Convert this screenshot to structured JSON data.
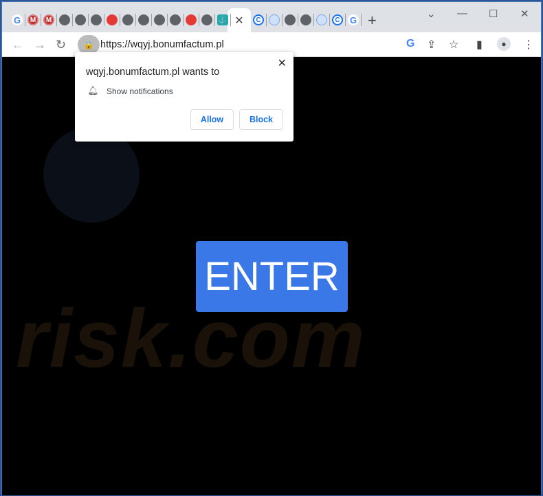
{
  "tabs": {
    "favicons": [
      "google",
      "mega",
      "mega",
      "globe",
      "globe",
      "globe",
      "red-circle",
      "globe",
      "globe",
      "globe",
      "globe",
      "red-circle",
      "globe",
      "shield",
      "ACTIVE",
      "refresh-blue",
      "bell-blue",
      "globe",
      "globe",
      "bell-blue",
      "refresh-blue",
      "google"
    ],
    "active_close": "✕",
    "new_tab": "+"
  },
  "window_controls": {
    "minimize": "⌄",
    "restore": "—",
    "maximize": "☐",
    "close": "✕"
  },
  "address_bar": {
    "url": "https://wqyj.bonumfactum.pl"
  },
  "popup": {
    "title": "wqyj.bonumfactum.pl wants to",
    "permission": "Show notifications",
    "allow": "Allow",
    "block": "Block",
    "close": "✕"
  },
  "page": {
    "enter_button": "ENTER",
    "watermark": "risk.com"
  },
  "colors": {
    "enter": "#3a78e8",
    "tabbar": "#dee1e6"
  }
}
